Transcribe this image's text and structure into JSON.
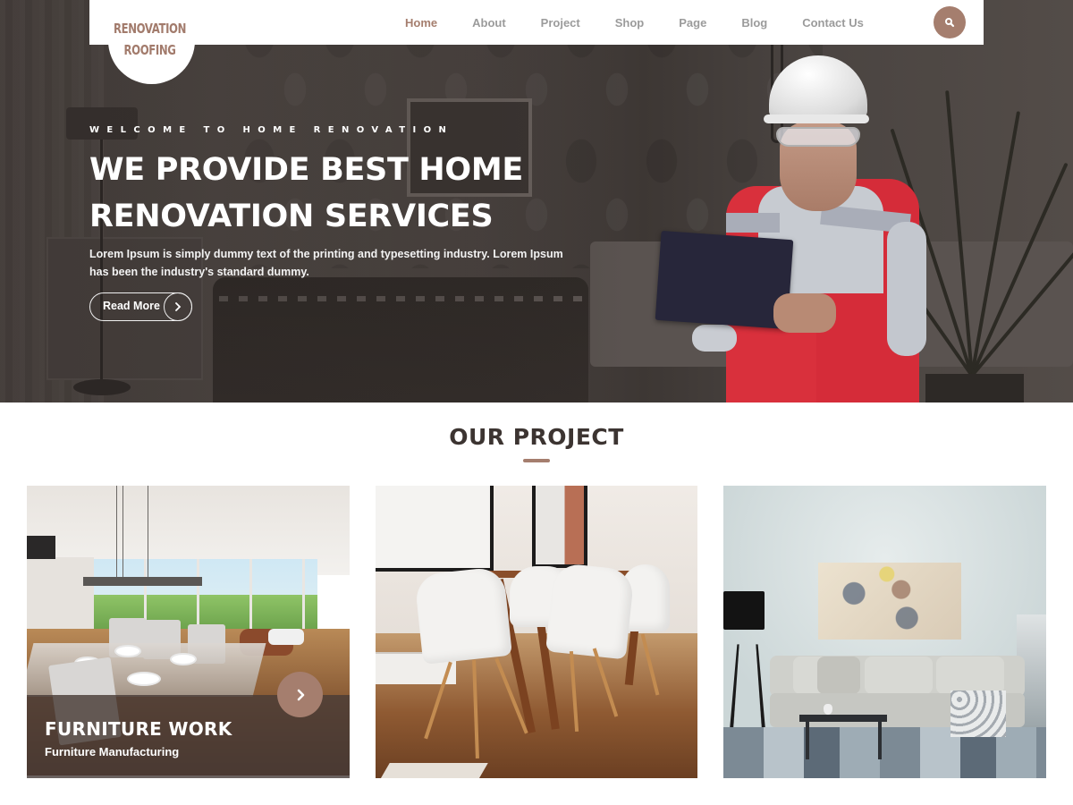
{
  "brand": {
    "logo_line1": "RENOVATION",
    "logo_line2": "ROOFING",
    "accent_color": "#a57e6e"
  },
  "nav": {
    "items": [
      {
        "label": "Home",
        "active": true
      },
      {
        "label": "About",
        "active": false
      },
      {
        "label": "Project",
        "active": false
      },
      {
        "label": "Shop",
        "active": false
      },
      {
        "label": "Page",
        "active": false
      },
      {
        "label": "Blog",
        "active": false
      },
      {
        "label": "Contact Us",
        "active": false
      }
    ],
    "search_icon": "search-icon"
  },
  "hero": {
    "eyebrow": "WELCOME TO HOME RENOVATION",
    "title_line1": "WE PROVIDE BEST HOME",
    "title_line2": "RENOVATION SERVICES",
    "description_line1": "Lorem Ipsum is simply dummy text of the printing and typesetting industry. Lorem Ipsum",
    "description_line2": "has been the industry's standard dummy.",
    "cta_label": "Read More",
    "cta_icon": "chevron-right-icon"
  },
  "projects": {
    "section_title": "OUR PROJECT",
    "cards": [
      {
        "title": "FURNITURE WORK",
        "subtitle": "Furniture Manufacturing",
        "image": "modern dining room with glass table",
        "arrow_icon": "chevron-right-icon"
      },
      {
        "image": "wooden dining table with white chairs"
      },
      {
        "image": "living room with grey sofa and abstract painting"
      }
    ]
  }
}
